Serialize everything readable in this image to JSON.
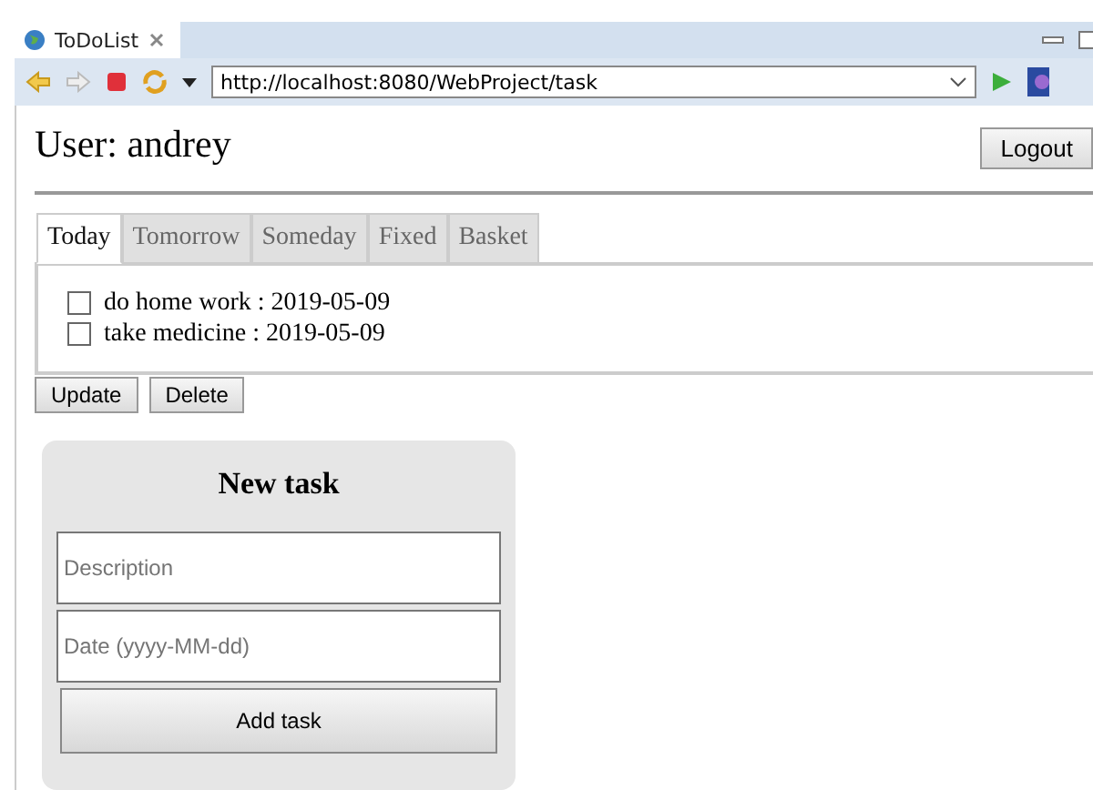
{
  "browser": {
    "tab_title": "ToDoList",
    "url": "http://localhost:8080/WebProject/task"
  },
  "header": {
    "user": "User: andrey",
    "logout": "Logout"
  },
  "tabs": [
    {
      "label": "Today",
      "selected": true
    },
    {
      "label": "Tomorrow",
      "selected": false
    },
    {
      "label": "Someday",
      "selected": false
    },
    {
      "label": "Fixed",
      "selected": false
    },
    {
      "label": "Basket",
      "selected": false
    }
  ],
  "tasks": [
    {
      "label": "do home work : 2019-05-09",
      "checked": false
    },
    {
      "label": "take medicine : 2019-05-09",
      "checked": false
    }
  ],
  "actions": [
    "Update",
    "Delete"
  ],
  "new_task": {
    "title": "New task",
    "description": {
      "placeholder": "Description"
    },
    "date": {
      "placeholder": "Date (yyyy-MM-dd)"
    },
    "submit": "Add task"
  }
}
